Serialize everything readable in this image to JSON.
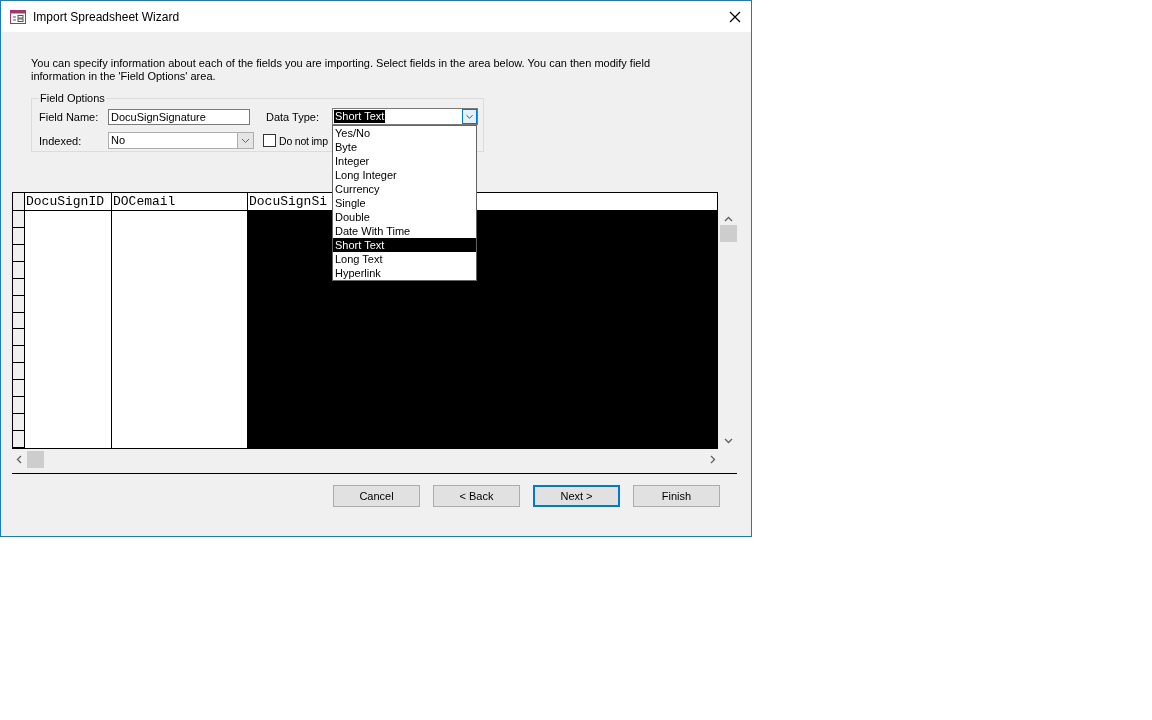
{
  "window": {
    "title": "Import Spreadsheet Wizard"
  },
  "instructions": "You can specify information about each of the fields you are importing. Select fields in the area below. You can then modify field information in the 'Field Options' area.",
  "field_options": {
    "legend": "Field Options",
    "field_name": {
      "label": "Field Name:",
      "value": "DocuSignSignature"
    },
    "data_type": {
      "label": "Data Type:",
      "value": "Short Text",
      "expanded": true,
      "options": [
        {
          "label": "Yes/No",
          "selected": false
        },
        {
          "label": "Byte",
          "selected": false
        },
        {
          "label": "Integer",
          "selected": false
        },
        {
          "label": "Long Integer",
          "selected": false
        },
        {
          "label": "Currency",
          "selected": false
        },
        {
          "label": "Single",
          "selected": false
        },
        {
          "label": "Double",
          "selected": false
        },
        {
          "label": "Date With Time",
          "selected": false
        },
        {
          "label": "Short Text",
          "selected": true
        },
        {
          "label": "Long Text",
          "selected": false
        },
        {
          "label": "Hyperlink",
          "selected": false
        }
      ]
    },
    "indexed": {
      "label": "Indexed:",
      "value": "No"
    },
    "skip_field": {
      "label": "Do not imp",
      "checked": false
    }
  },
  "grid": {
    "columns": [
      {
        "header": "DocuSignID",
        "selected": false
      },
      {
        "header": "DOCemail",
        "selected": false
      },
      {
        "header": "DocuSignSi",
        "selected": true
      }
    ]
  },
  "buttons": [
    {
      "label": "Cancel",
      "default": false
    },
    {
      "label": "< Back",
      "default": false
    },
    {
      "label": "Next >",
      "default": true
    },
    {
      "label": "Finish",
      "default": false
    }
  ]
}
